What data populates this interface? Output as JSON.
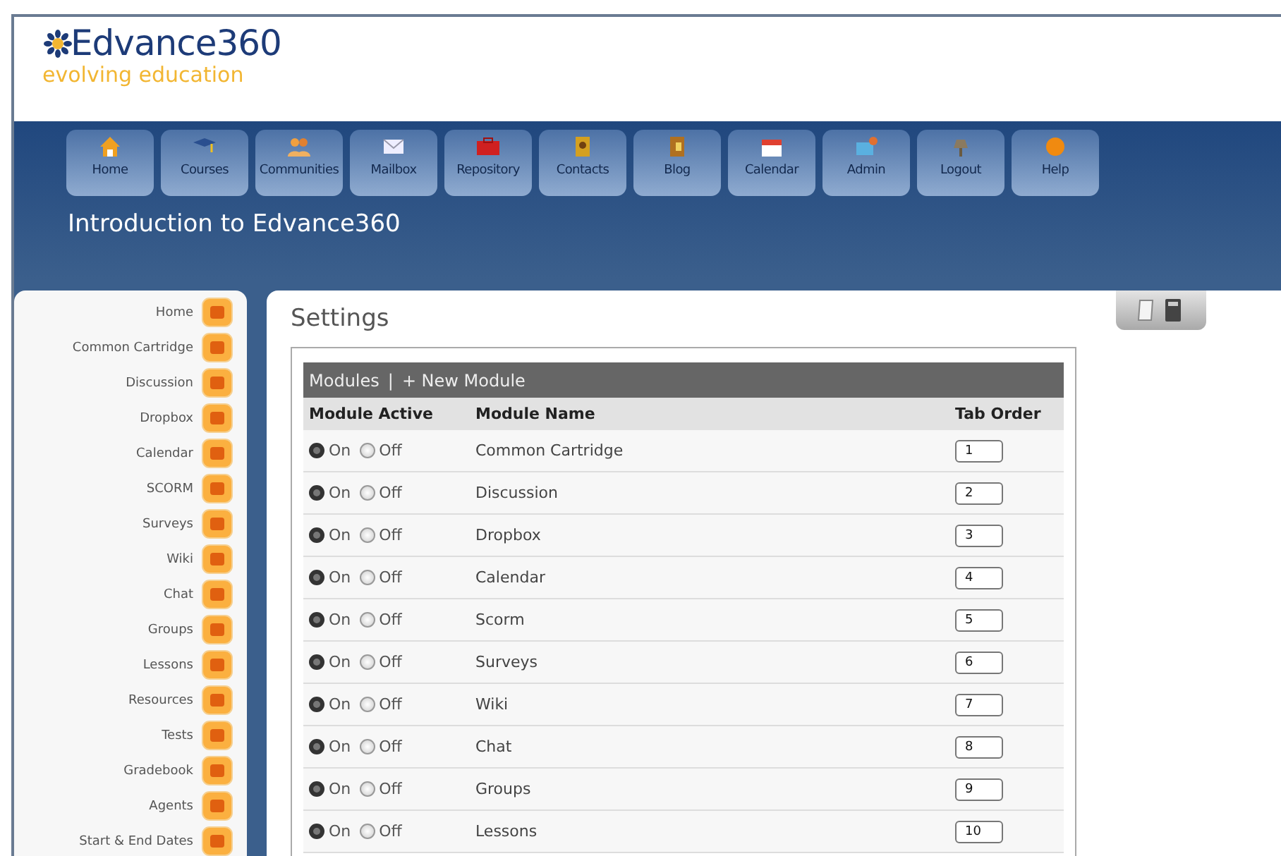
{
  "logo": {
    "name": "Edvance360",
    "tagline": "evolving education"
  },
  "nav": [
    {
      "label": "Home",
      "kind": "home"
    },
    {
      "label": "Courses",
      "kind": "courses"
    },
    {
      "label": "Communities",
      "kind": "communities"
    },
    {
      "label": "Mailbox",
      "kind": "mailbox"
    },
    {
      "label": "Repository",
      "kind": "repository"
    },
    {
      "label": "Contacts",
      "kind": "contacts"
    },
    {
      "label": "Blog",
      "kind": "blog"
    },
    {
      "label": "Calendar",
      "kind": "calendar"
    },
    {
      "label": "Admin",
      "kind": "admin"
    },
    {
      "label": "Logout",
      "kind": "logout"
    },
    {
      "label": "Help",
      "kind": "help"
    }
  ],
  "course_title": "Introduction to Edvance360",
  "sidebar": {
    "items": [
      "Home",
      "Common Cartridge",
      "Discussion",
      "Dropbox",
      "Calendar",
      "SCORM",
      "Surveys",
      "Wiki",
      "Chat",
      "Groups",
      "Lessons",
      "Resources",
      "Tests",
      "Gradebook",
      "Agents",
      "Start & End Dates"
    ]
  },
  "page_title": "Settings",
  "modules": {
    "tab": "Modules",
    "separator": "|",
    "new_link": "+ New Module",
    "columns": [
      "Module Active",
      "Module Name",
      "Tab Order"
    ],
    "rows": [
      {
        "options": [
          {
            "label": "On",
            "selected": true
          },
          {
            "label": "Off",
            "selected": false
          }
        ],
        "name": "Common Cartridge",
        "order": "1"
      },
      {
        "options": [
          {
            "label": "On",
            "selected": true
          },
          {
            "label": "Off",
            "selected": false
          }
        ],
        "name": "Discussion",
        "order": "2"
      },
      {
        "options": [
          {
            "label": "On",
            "selected": true
          },
          {
            "label": "Off",
            "selected": false
          }
        ],
        "name": "Dropbox",
        "order": "3"
      },
      {
        "options": [
          {
            "label": "On",
            "selected": true
          },
          {
            "label": "Off",
            "selected": false
          }
        ],
        "name": "Calendar",
        "order": "4"
      },
      {
        "options": [
          {
            "label": "On",
            "selected": true
          },
          {
            "label": "Off",
            "selected": false
          }
        ],
        "name": "Scorm",
        "order": "5"
      },
      {
        "options": [
          {
            "label": "On",
            "selected": true
          },
          {
            "label": "Off",
            "selected": false
          }
        ],
        "name": "Surveys",
        "order": "6"
      },
      {
        "options": [
          {
            "label": "On",
            "selected": true
          },
          {
            "label": "Off",
            "selected": false
          }
        ],
        "name": "Wiki",
        "order": "7"
      },
      {
        "options": [
          {
            "label": "On",
            "selected": true
          },
          {
            "label": "Off",
            "selected": false
          }
        ],
        "name": "Chat",
        "order": "8"
      },
      {
        "options": [
          {
            "label": "On",
            "selected": true
          },
          {
            "label": "Off",
            "selected": false
          }
        ],
        "name": "Groups",
        "order": "9"
      },
      {
        "options": [
          {
            "label": "On",
            "selected": true
          },
          {
            "label": "Off",
            "selected": false
          }
        ],
        "name": "Lessons",
        "order": "10"
      }
    ]
  }
}
